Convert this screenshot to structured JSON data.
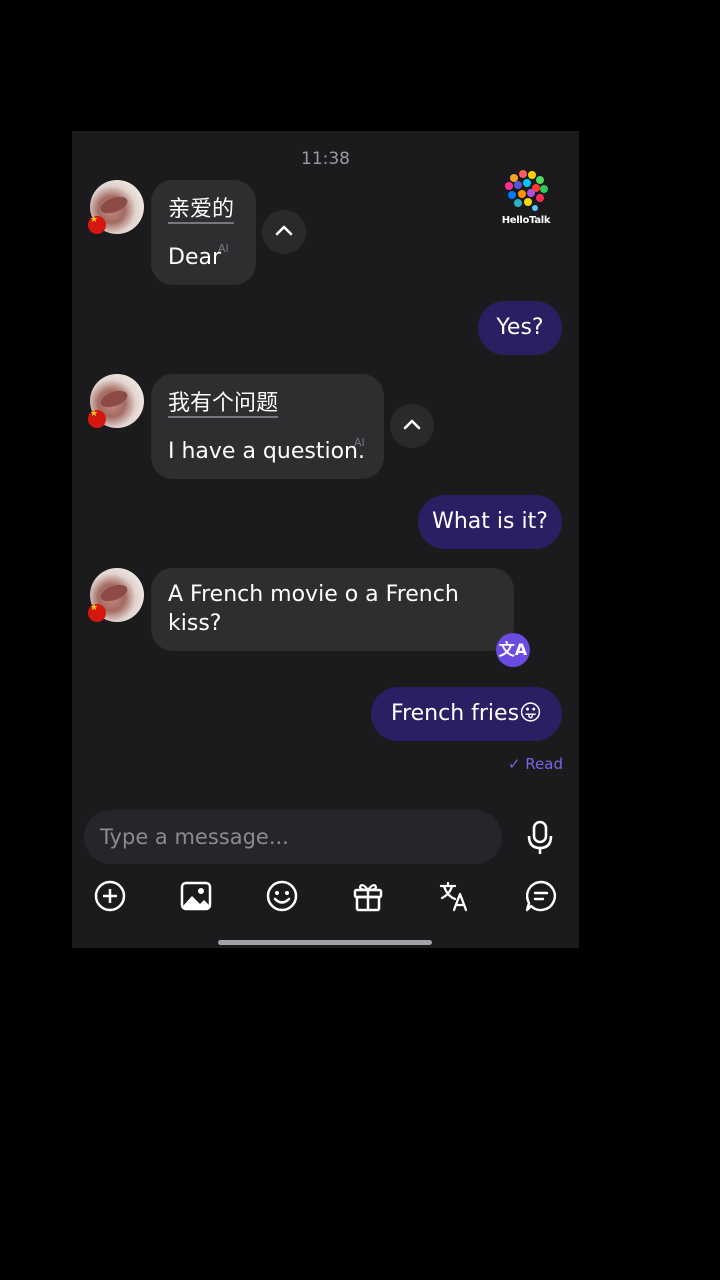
{
  "status": {
    "time": "11:38"
  },
  "brand": {
    "logo_text": "HelloTalk"
  },
  "messages": [
    {
      "direction": "in",
      "original": [
        "亲",
        "爱",
        "的"
      ],
      "translation": "Dear",
      "ai_tag": "AI"
    },
    {
      "direction": "out",
      "text": "Yes?"
    },
    {
      "direction": "in",
      "original": [
        "我",
        "有",
        "个",
        "问",
        "题"
      ],
      "translation": "I have a question.",
      "ai_tag": "AI"
    },
    {
      "direction": "out",
      "text": "What is it?"
    },
    {
      "direction": "in",
      "text_line1": "A French movie o a French",
      "text_line2": "kiss?"
    },
    {
      "direction": "out",
      "text": "French fries😛"
    }
  ],
  "read_status": "✓ Read",
  "composer": {
    "placeholder": "Type a message..."
  },
  "toolbar": [
    "plus-icon",
    "image-icon",
    "emoji-icon",
    "gift-icon",
    "translate-icon",
    "chat-icon"
  ],
  "colors": {
    "background": "#1b1b1d",
    "incoming": "#2e2e31",
    "outgoing": "#2b1f63",
    "accent": "#7e63e8"
  }
}
